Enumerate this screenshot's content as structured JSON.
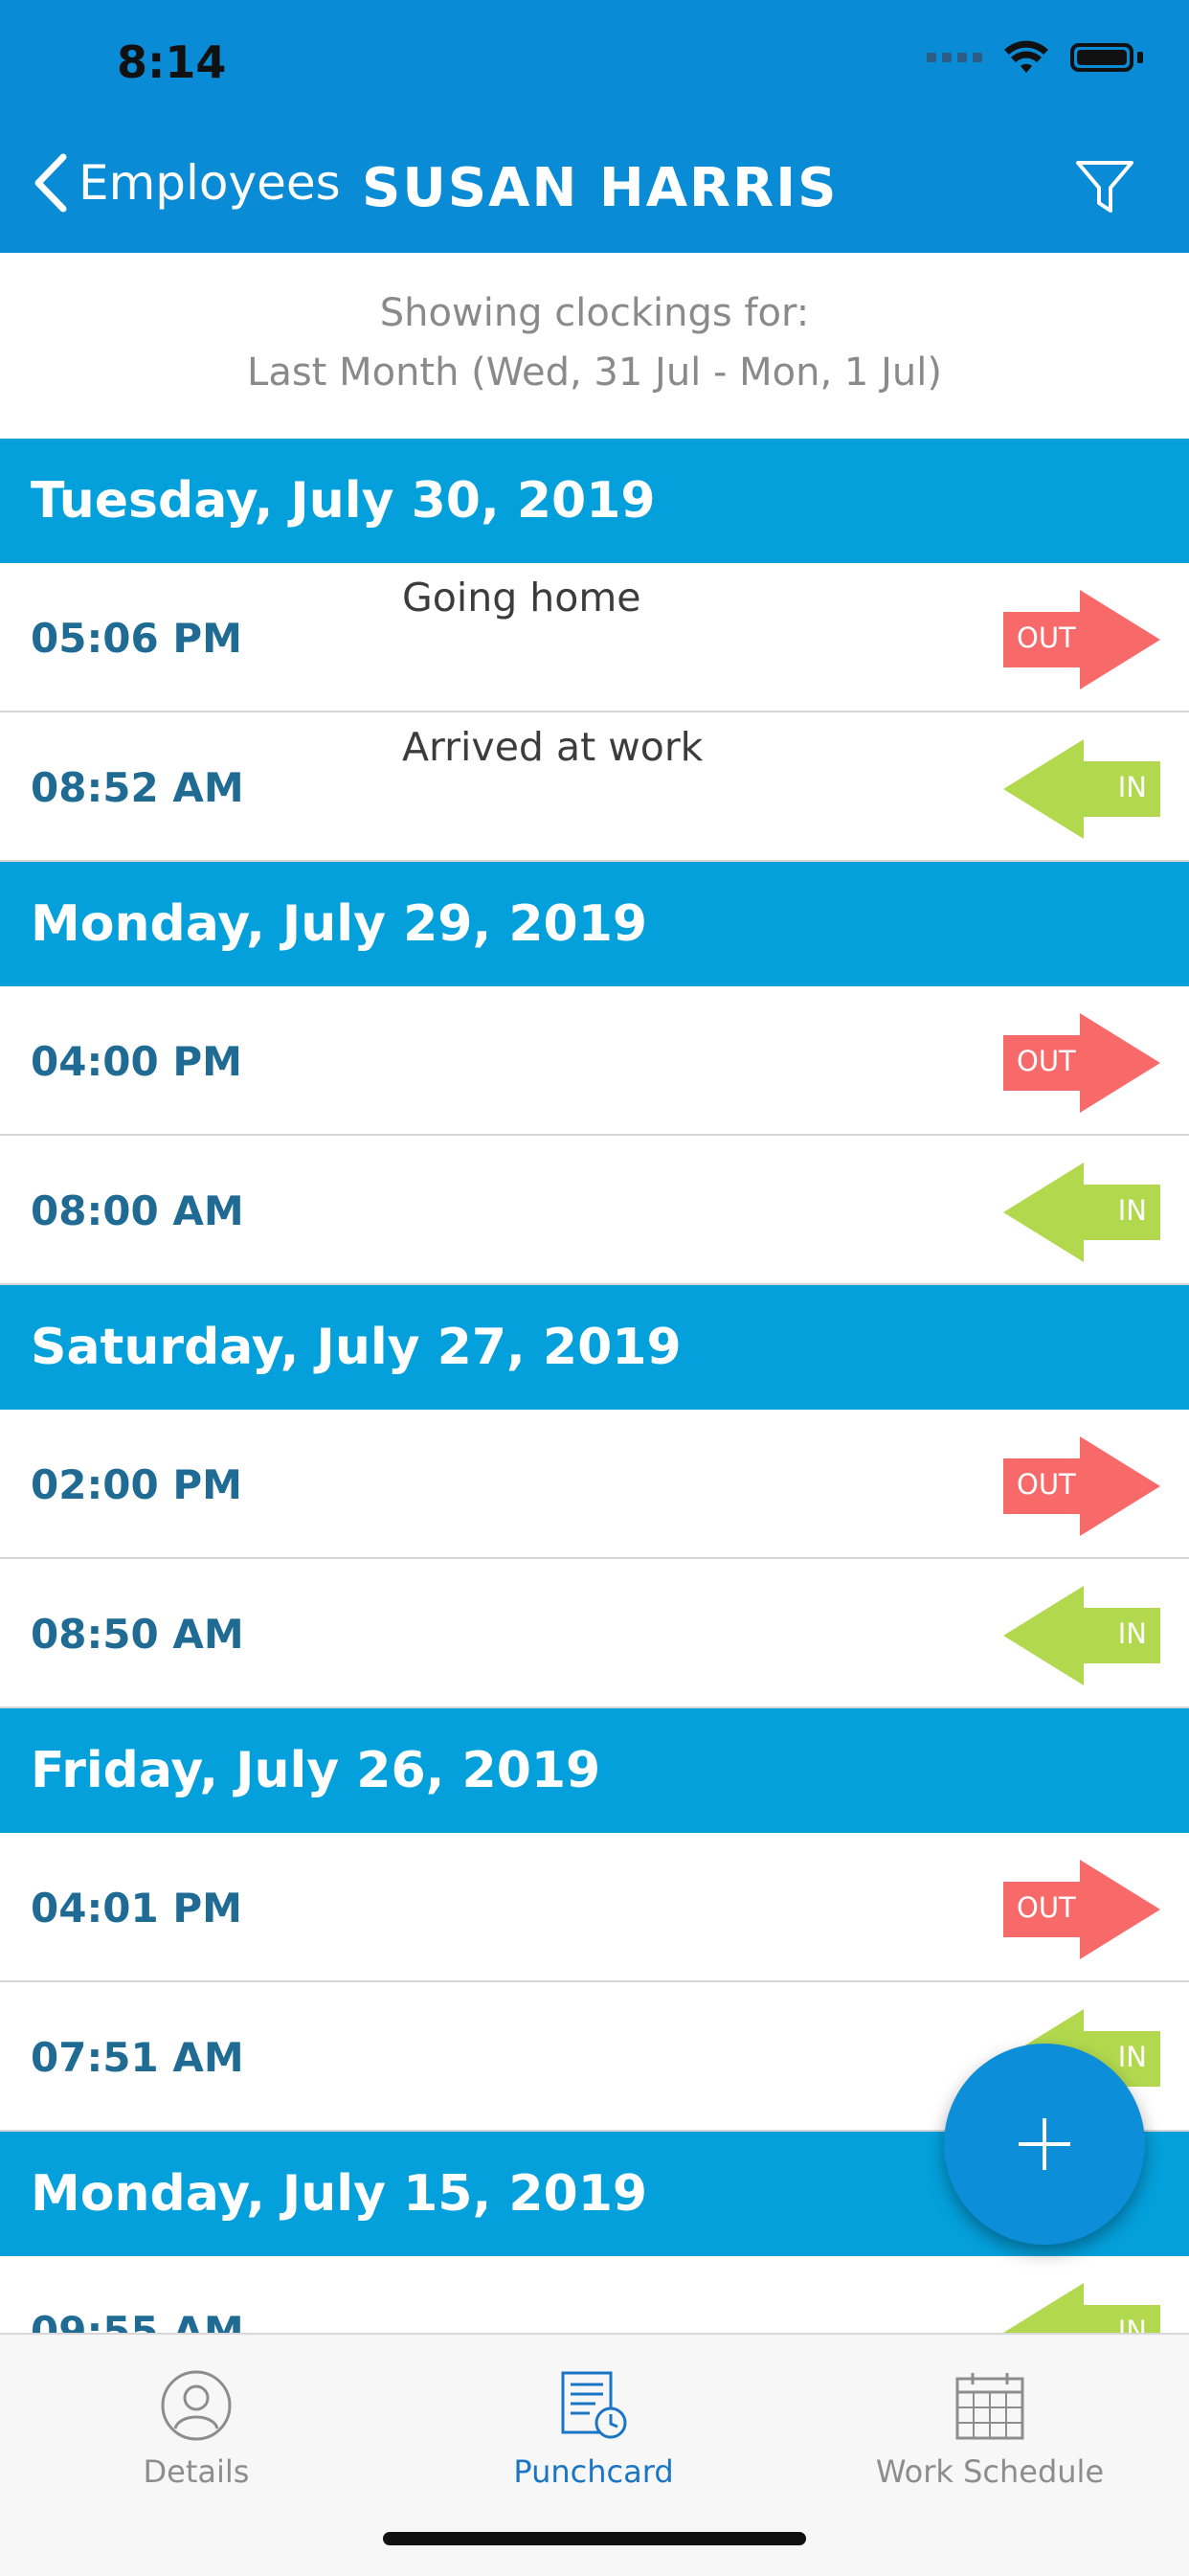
{
  "status_bar": {
    "time": "8:14"
  },
  "header": {
    "back_label": "Employees",
    "title": "SUSAN HARRIS"
  },
  "filter_info": {
    "line1": "Showing clockings for:",
    "line2": "Last Month (Wed, 31 Jul - Mon, 1 Jul)"
  },
  "days": [
    {
      "date": "Tuesday, July 30, 2019",
      "entries": [
        {
          "time": "05:06 PM",
          "note": "Going home",
          "type": "OUT"
        },
        {
          "time": "08:52 AM",
          "note": "Arrived at work",
          "type": "IN"
        }
      ]
    },
    {
      "date": "Monday, July 29, 2019",
      "entries": [
        {
          "time": "04:00 PM",
          "note": "",
          "type": "OUT"
        },
        {
          "time": "08:00 AM",
          "note": "",
          "type": "IN"
        }
      ]
    },
    {
      "date": "Saturday, July 27, 2019",
      "entries": [
        {
          "time": "02:00 PM",
          "note": "",
          "type": "OUT"
        },
        {
          "time": "08:50 AM",
          "note": "",
          "type": "IN"
        }
      ]
    },
    {
      "date": "Friday, July 26, 2019",
      "entries": [
        {
          "time": "04:01 PM",
          "note": "",
          "type": "OUT"
        },
        {
          "time": "07:51 AM",
          "note": "",
          "type": "IN"
        }
      ]
    },
    {
      "date": "Monday, July 15, 2019",
      "entries": [
        {
          "time": "09:55 AM",
          "note": "",
          "type": "IN"
        }
      ]
    }
  ],
  "colors": {
    "header_blue": "#0a8bd6",
    "day_blue": "#04a0dc",
    "out_red": "#f86a6a",
    "in_green": "#b2d94e",
    "time_text": "#1f6b94"
  },
  "tabs": [
    {
      "label": "Details",
      "icon": "person-icon",
      "active": false
    },
    {
      "label": "Punchcard",
      "icon": "punchcard-icon",
      "active": true
    },
    {
      "label": "Work Schedule",
      "icon": "calendar-icon",
      "active": false
    }
  ]
}
